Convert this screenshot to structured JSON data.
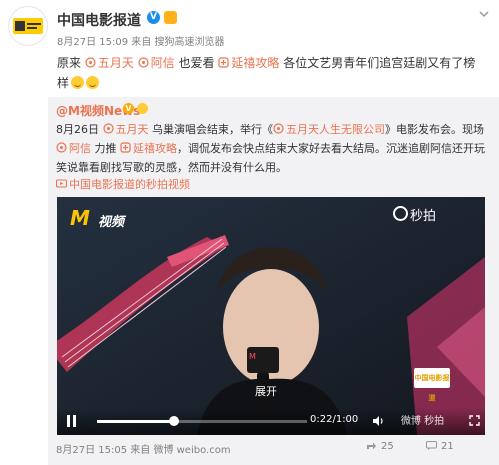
{
  "post": {
    "author": "中国电影报道",
    "verified_badge": "V",
    "meta": "8月27日 15:09 来自 搜狗高速浏览器",
    "text_prefix": "原来",
    "mention1": "五月天",
    "mention2": "阿信",
    "text_mid": "也爱看",
    "hashtag": "延禧攻略",
    "text_suffix": "各位文艺男青年们追宫廷剧又有了榜样"
  },
  "repost": {
    "author": "@M视频News",
    "verified_badge": "V",
    "date": "8月26日",
    "mention_band": "五月天",
    "text1": "乌巢演唱会结束，举行《",
    "link_company": "五月天人生无限公司",
    "text2": "》电影发布会。现场",
    "mention_axin": "阿信",
    "text3": "力推",
    "hashtag": "延禧攻略",
    "text4": "，调侃发布会快点结束大家好去看大结局。沉迷追剧阿信还开玩笑说靠看剧找写歌的灵感，然而并没有什么用。",
    "source_link": "中国电影报道的秒拍视频",
    "footer_meta": "8月27日 15:05 来自 微博 weibo.com"
  },
  "video": {
    "brand_m": "M",
    "brand_text": "视频",
    "provider": "秒拍",
    "expand_label": "展开",
    "time": "0:22/1:00",
    "progress": 0.367,
    "weibo_watermark": "微博 秒拍",
    "corner_logo": "中国电影报道"
  },
  "actions": {
    "share_count": "25",
    "comment_count": "21"
  },
  "colors": {
    "link": "#eb7350",
    "accent": "#ffc400"
  }
}
